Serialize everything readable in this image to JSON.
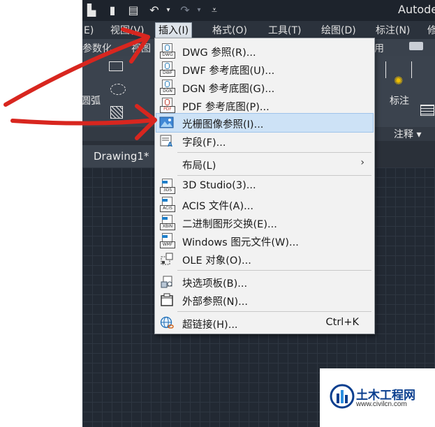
{
  "app": {
    "title": "Autode"
  },
  "menubar": {
    "items": [
      {
        "label": "E)"
      },
      {
        "label": "视图(V)"
      },
      {
        "label": "插入(I)"
      },
      {
        "label": "格式(O)"
      },
      {
        "label": "工具(T)"
      },
      {
        "label": "绘图(D)"
      },
      {
        "label": "标注(N)"
      },
      {
        "label": "修"
      }
    ]
  },
  "ribbon": {
    "tabs": [
      {
        "label": "参数化"
      },
      {
        "label": "视图"
      },
      {
        "label": "用"
      }
    ],
    "arc_label": "圆弧",
    "annotate_label": "标注",
    "annotation_panel": "注释 ▾"
  },
  "document": {
    "tab_label": "Drawing1*"
  },
  "insert_menu": {
    "items": [
      {
        "label": "DWG 参照(R)...",
        "icon": "dwg-icon"
      },
      {
        "label": "DWF 参考底图(U)...",
        "icon": "dwf-icon"
      },
      {
        "label": "DGN 参考底图(G)...",
        "icon": "dgn-icon"
      },
      {
        "label": "PDF 参考底图(P)...",
        "icon": "pdf-icon"
      },
      {
        "label": "光栅图像参照(I)...",
        "icon": "raster-image-icon"
      },
      {
        "label": "字段(F)...",
        "icon": "field-icon"
      },
      {
        "label": "布局(L)",
        "icon": ""
      },
      {
        "label": "3D Studio(3)...",
        "icon": "3ds-icon"
      },
      {
        "label": "ACIS 文件(A)...",
        "icon": "acis-icon"
      },
      {
        "label": "二进制图形交换(E)...",
        "icon": "dxb-icon"
      },
      {
        "label": "Windows 图元文件(W)...",
        "icon": "wmf-icon"
      },
      {
        "label": "OLE 对象(O)...",
        "icon": "ole-icon"
      },
      {
        "label": "块选项板(B)...",
        "icon": "block-palette-icon"
      },
      {
        "label": "外部参照(N)...",
        "icon": "xref-icon"
      },
      {
        "label": "超链接(H)...",
        "icon": "hyperlink-icon",
        "shortcut": "Ctrl+K"
      }
    ],
    "file_tags": {
      "dwg": "DWG",
      "dwf": "DWF",
      "dgn": "DGN",
      "pdf": "PDF",
      "3ds": "3DS",
      "acis": "ACIS",
      "dxb": "XBIN",
      "wmf": "WMF"
    }
  },
  "watermark": {
    "name": "土木工程网",
    "url": "www.civilcn.com"
  },
  "colors": {
    "menu_highlight": "#cde2f6",
    "annotation_red": "#d8261f",
    "canvas": "#222933"
  }
}
